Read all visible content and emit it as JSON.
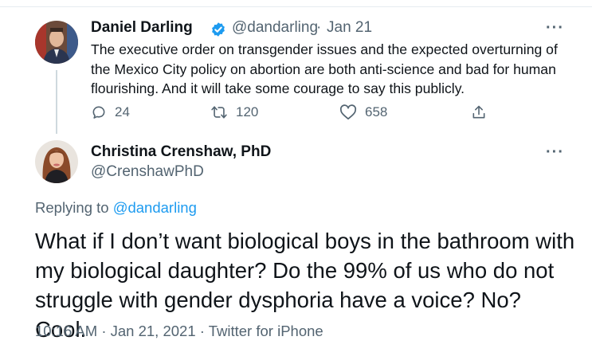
{
  "tweet1": {
    "author_name": "Daniel Darling",
    "handle": "@dandarling",
    "separator": "·",
    "date": "Jan 21",
    "text": "The executive order on transgender issues and the expected overturning of the Mexico City policy on abortion are both anti-science and bad for human flourishing. And it will take some courage to say this publicly.",
    "reply_count": "24",
    "retweet_count": "120",
    "like_count": "658",
    "verified": true
  },
  "tweet2": {
    "author_name": "Christina Crenshaw, PhD",
    "handle": "@CrenshawPhD",
    "replying_prefix": "Replying to",
    "replying_to": "@dandarling",
    "text": "What if I don’t want biological boys in the bathroom with my biological daughter? Do the 99% of us who do not struggle with gender dysphoria have a voice? No? Cool.",
    "time": "10:16 AM",
    "date": "Jan 21, 2021",
    "source": "Twitter for iPhone",
    "sep": "·"
  },
  "more_label": "···",
  "colors": {
    "accent": "#1d9bf0",
    "secondary_text": "#536471",
    "primary_text": "#0f1419"
  }
}
